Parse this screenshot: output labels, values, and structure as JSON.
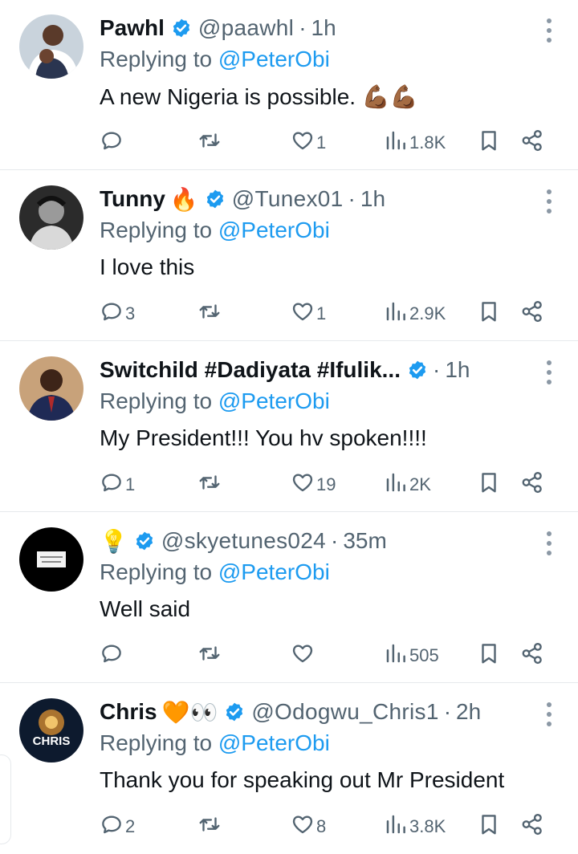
{
  "replies": [
    {
      "name": "Pawhl",
      "handle": "@paawhl",
      "time": "1h",
      "replying_prefix": "Replying to ",
      "replying_to": "@PeterObi",
      "text": "A new Nigeria is possible. 💪🏾💪🏾",
      "name_emoji": "",
      "counts": {
        "replies": "",
        "retweets": "",
        "likes": "1",
        "views": "1.8K"
      }
    },
    {
      "name": "Tunny",
      "handle": "@Tunex01",
      "time": "1h",
      "replying_prefix": "Replying to ",
      "replying_to": "@PeterObi",
      "text": "I love this",
      "name_emoji": "🔥",
      "counts": {
        "replies": "3",
        "retweets": "",
        "likes": "1",
        "views": "2.9K"
      }
    },
    {
      "name": "Switchild #Dadiyata #Ifulik...",
      "handle": "",
      "time": "1h",
      "replying_prefix": "Replying to ",
      "replying_to": "@PeterObi",
      "text": "My President!!! You hv spoken!!!!",
      "name_emoji": "",
      "counts": {
        "replies": "1",
        "retweets": "",
        "likes": "19",
        "views": "2K"
      }
    },
    {
      "name": "",
      "handle": "@skyetunes024",
      "time": "35m",
      "replying_prefix": "Replying to ",
      "replying_to": "@PeterObi",
      "text": "Well said",
      "name_emoji": "💡",
      "counts": {
        "replies": "",
        "retweets": "",
        "likes": "",
        "views": "505"
      }
    },
    {
      "name": "Chris",
      "handle": "@Odogwu_Chris1",
      "time": "2h",
      "replying_prefix": "Replying to ",
      "replying_to": "@PeterObi",
      "text": "Thank you for speaking out Mr President",
      "name_emoji": "🧡👀",
      "counts": {
        "replies": "2",
        "retweets": "",
        "likes": "8",
        "views": "3.8K"
      }
    }
  ],
  "avatar_4_text": "CHRIS",
  "colors": {
    "accent": "#1d9bf0",
    "muted": "#536471",
    "text": "#0f1419",
    "divider": "#e6e9ec"
  },
  "icons": [
    "verified-badge-icon",
    "more-options-icon",
    "reply-icon",
    "retweet-icon",
    "like-icon",
    "views-icon",
    "bookmark-icon",
    "share-icon"
  ]
}
